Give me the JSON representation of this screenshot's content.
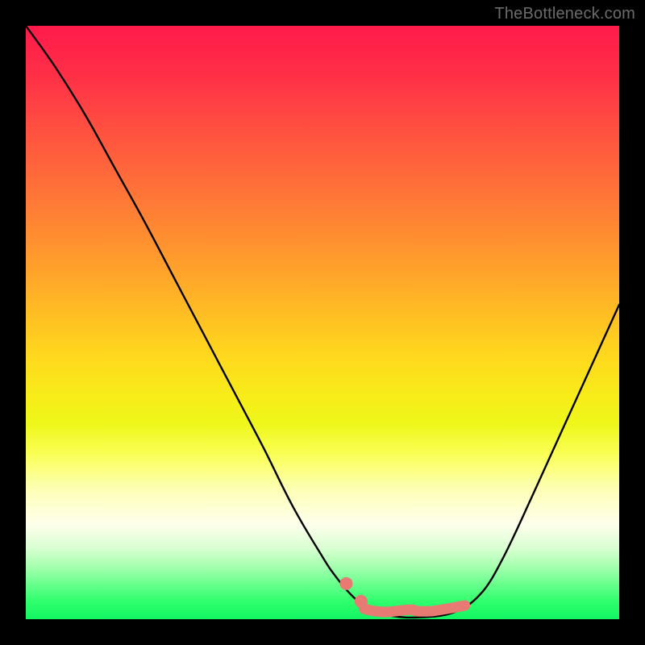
{
  "watermark": "TheBottleneck.com",
  "colors": {
    "curve": "#000000",
    "annotation": "#e77a73",
    "gradient_top": "#ff1a4a",
    "gradient_bottom": "#13f563"
  },
  "chart_data": {
    "type": "line",
    "title": "",
    "xlabel": "",
    "ylabel": "",
    "xlim": [
      0,
      100
    ],
    "ylim": [
      0,
      100
    ],
    "grid": false,
    "legend": false,
    "annotations": [
      {
        "kind": "flat_highlight",
        "x_start": 57,
        "x_end": 74,
        "y": 1.5
      },
      {
        "kind": "dot",
        "x": 54,
        "y": 6
      },
      {
        "kind": "dot",
        "x": 56.5,
        "y": 3
      }
    ],
    "series": [
      {
        "name": "bottleneck-curve",
        "x": [
          0,
          5,
          10,
          15,
          20,
          25,
          30,
          35,
          40,
          45,
          50,
          52,
          54,
          56,
          58,
          60,
          62,
          64,
          66,
          68,
          70,
          72,
          74,
          76,
          78,
          80,
          82,
          85,
          90,
          95,
          100
        ],
        "values": [
          100,
          93,
          85,
          76,
          67,
          57.5,
          48,
          38.5,
          29,
          19,
          10.5,
          7.5,
          5,
          3,
          1.6,
          0.9,
          0.5,
          0.3,
          0.3,
          0.4,
          0.6,
          1.1,
          2,
          3.6,
          6,
          9.5,
          13.5,
          20,
          31,
          42,
          53
        ]
      }
    ]
  }
}
